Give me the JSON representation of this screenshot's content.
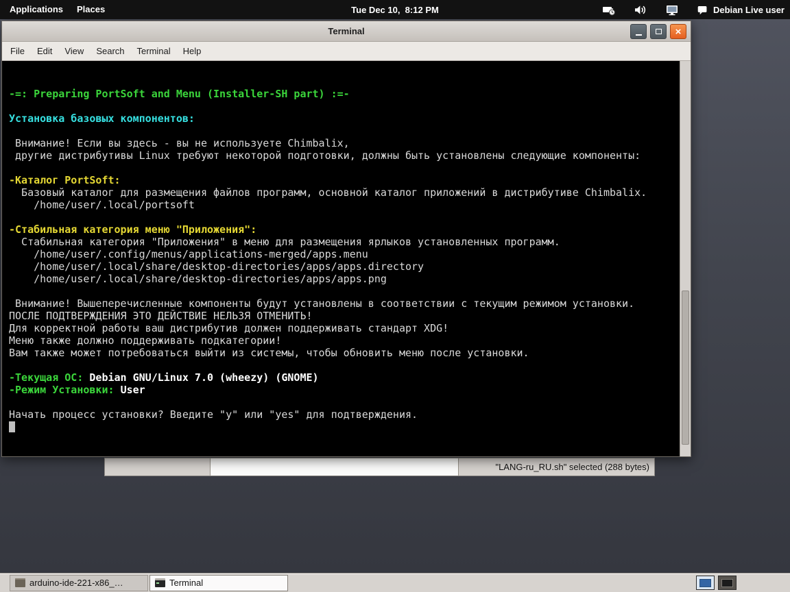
{
  "topbar": {
    "applications": "Applications",
    "places": "Places",
    "clock": "Tue Dec 10,  8:12 PM",
    "user_label": "Debian Live user",
    "tray_icons": [
      "battery-clock-icon",
      "volume-icon",
      "display-icon",
      "user-status-icon"
    ]
  },
  "terminal_window": {
    "title": "Terminal",
    "menu_items": [
      "File",
      "Edit",
      "View",
      "Search",
      "Terminal",
      "Help"
    ],
    "colors": {
      "background": "#000000",
      "text": "#d9d9d9",
      "green": "#3bd53b",
      "cyan": "#36dfe0",
      "yellow": "#e4d733",
      "bold_white": "#ffffff"
    }
  },
  "terminal": {
    "lines": [
      {
        "segments": [
          {
            "text": "-=: Preparing PortSoft and Menu (Installer-SH part) :=-",
            "style": "green"
          }
        ]
      },
      {
        "segments": []
      },
      {
        "segments": [
          {
            "text": "Установка базовых компонентов:",
            "style": "cyan"
          }
        ]
      },
      {
        "segments": []
      },
      {
        "segments": [
          {
            "text": " Внимание! Если вы здесь - вы не используете Chimbalix,",
            "style": "plain"
          }
        ]
      },
      {
        "segments": [
          {
            "text": " другие дистрибутивы Linux требуют некоторой подготовки, должны быть установлены следующие компоненты:",
            "style": "plain"
          }
        ]
      },
      {
        "segments": []
      },
      {
        "segments": [
          {
            "text": "-Каталог PortSoft:",
            "style": "yellow"
          }
        ]
      },
      {
        "segments": [
          {
            "text": "  Базовый каталог для размещения файлов программ, основной каталог приложений в дистрибутиве Chimbalix.",
            "style": "plain"
          }
        ]
      },
      {
        "segments": [
          {
            "text": "    /home/user/.local/portsoft",
            "style": "plain"
          }
        ]
      },
      {
        "segments": []
      },
      {
        "segments": [
          {
            "text": "-Стабильная категория меню \"Приложения\":",
            "style": "yellow"
          }
        ]
      },
      {
        "segments": [
          {
            "text": "  Стабильная категория \"Приложения\" в меню для размещения ярлыков установленных программ.",
            "style": "plain"
          }
        ]
      },
      {
        "segments": [
          {
            "text": "    /home/user/.config/menus/applications-merged/apps.menu",
            "style": "plain"
          }
        ]
      },
      {
        "segments": [
          {
            "text": "    /home/user/.local/share/desktop-directories/apps/apps.directory",
            "style": "plain"
          }
        ]
      },
      {
        "segments": [
          {
            "text": "    /home/user/.local/share/desktop-directories/apps/apps.png",
            "style": "plain"
          }
        ]
      },
      {
        "segments": []
      },
      {
        "segments": [
          {
            "text": " Внимание! Вышеперечисленные компоненты будут установлены в соответствии с текущим режимом установки.",
            "style": "plain"
          }
        ]
      },
      {
        "segments": [
          {
            "text": "ПОСЛЕ ПОДТВЕРЖДЕНИЯ ЭТО ДЕЙСТВИЕ НЕЛЬЗЯ ОТМЕНИТЬ!",
            "style": "plain"
          }
        ]
      },
      {
        "segments": [
          {
            "text": "Для корректной работы ваш дистрибутив должен поддерживать стандарт XDG!",
            "style": "plain"
          }
        ]
      },
      {
        "segments": [
          {
            "text": "Меню также должно поддерживать подкатегории!",
            "style": "plain"
          }
        ]
      },
      {
        "segments": [
          {
            "text": "Вам также может потребоваться выйти из системы, чтобы обновить меню после установки.",
            "style": "plain"
          }
        ]
      },
      {
        "segments": []
      },
      {
        "segments": [
          {
            "text": "-Текущая ОС: ",
            "style": "green"
          },
          {
            "text": "Debian GNU/Linux 7.0 (wheezy) (GNOME)",
            "style": "boldwhite"
          }
        ]
      },
      {
        "segments": [
          {
            "text": "-Режим Установки: ",
            "style": "green"
          },
          {
            "text": "User",
            "style": "boldwhite"
          }
        ]
      },
      {
        "segments": []
      },
      {
        "segments": [
          {
            "text": "Начать процесс установки? Введите \"y\" или \"yes\" для подтверждения.",
            "style": "plain"
          }
        ]
      },
      {
        "segments": [],
        "cursor": true
      }
    ]
  },
  "file_manager": {
    "selection_text": "\"LANG-ru_RU.sh\" selected (288 bytes)"
  },
  "taskbar": {
    "items": [
      {
        "icon": "archive-icon",
        "label": "arduino-ide-221-x86_…",
        "active": false
      },
      {
        "icon": "terminal-icon",
        "label": "Terminal",
        "active": true
      }
    ],
    "workspaces": [
      {
        "active": true
      },
      {
        "active": false
      }
    ]
  }
}
